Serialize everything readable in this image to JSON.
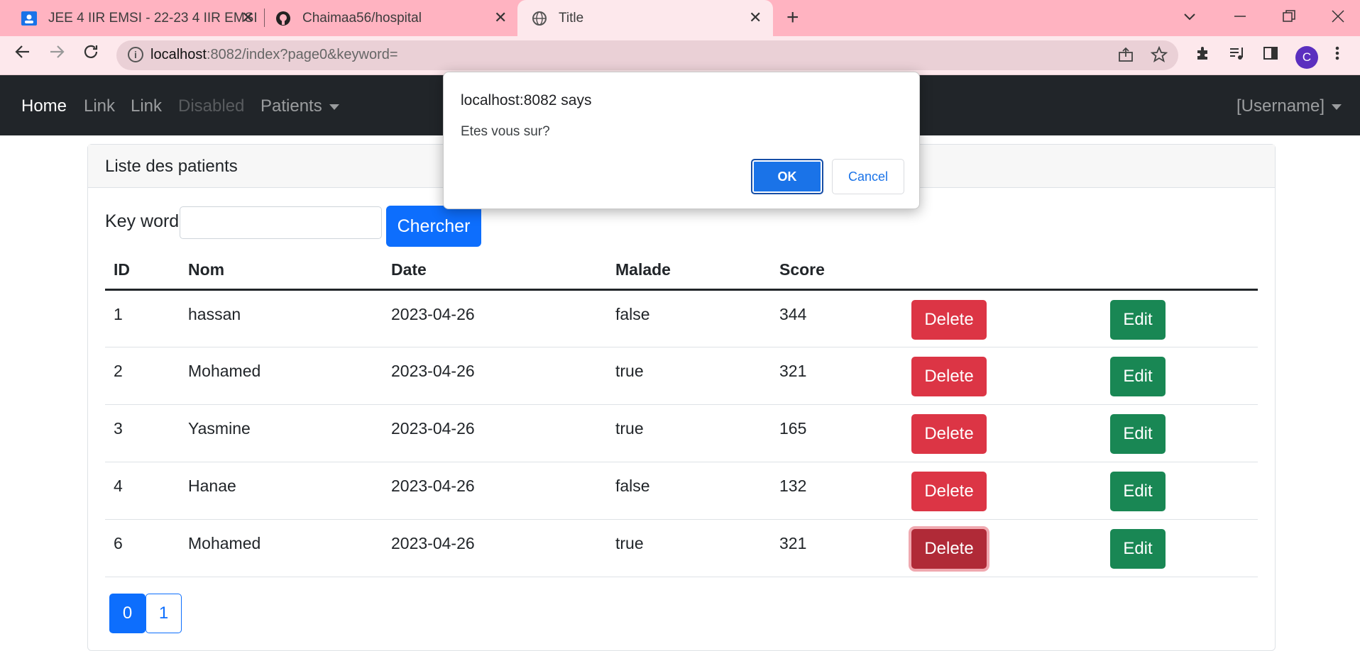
{
  "browser": {
    "tabs": [
      {
        "title": "JEE 4 IIR EMSI - 22-23 4 IIR EMSI",
        "icon": "classroom-icon"
      },
      {
        "title": "Chaimaa56/hospital",
        "icon": "github-icon"
      },
      {
        "title": "Title",
        "icon": "globe-icon"
      }
    ],
    "close_glyph": "✕",
    "new_tab_glyph": "+",
    "url_host": "localhost",
    "url_path": ":8082/index?page0&keyword=",
    "profile_initial": "C"
  },
  "navbar": {
    "items": [
      {
        "label": "Home",
        "state": "active"
      },
      {
        "label": "Link",
        "state": "normal"
      },
      {
        "label": "Link",
        "state": "normal"
      },
      {
        "label": "Disabled",
        "state": "disabled"
      },
      {
        "label": "Patients",
        "state": "dropdown"
      }
    ],
    "user": "[Username]"
  },
  "card": {
    "header": "Liste des patients",
    "search_label": "Key word",
    "search_value": "",
    "search_button": "Chercher"
  },
  "table": {
    "columns": [
      "ID",
      "Nom",
      "Date",
      "Malade",
      "Score"
    ],
    "rows": [
      {
        "id": "1",
        "nom": "hassan",
        "date": "2023-04-26",
        "malade": "false",
        "score": "344"
      },
      {
        "id": "2",
        "nom": "Mohamed",
        "date": "2023-04-26",
        "malade": "true",
        "score": "321"
      },
      {
        "id": "3",
        "nom": "Yasmine",
        "date": "2023-04-26",
        "malade": "true",
        "score": "165"
      },
      {
        "id": "4",
        "nom": "Hanae",
        "date": "2023-04-26",
        "malade": "false",
        "score": "132"
      },
      {
        "id": "6",
        "nom": "Mohamed",
        "date": "2023-04-26",
        "malade": "true",
        "score": "321"
      }
    ],
    "delete_label": "Delete",
    "edit_label": "Edit"
  },
  "pagination": {
    "pages": [
      "0",
      "1"
    ],
    "current": "0"
  },
  "dialog": {
    "title": "localhost:8082 says",
    "message": "Etes vous sur?",
    "ok": "OK",
    "cancel": "Cancel"
  },
  "colors": {
    "tabstrip": "#ffb3c1",
    "navbar": "#212529",
    "danger": "#dc3545",
    "success": "#198754",
    "primary": "#0d6efd"
  }
}
